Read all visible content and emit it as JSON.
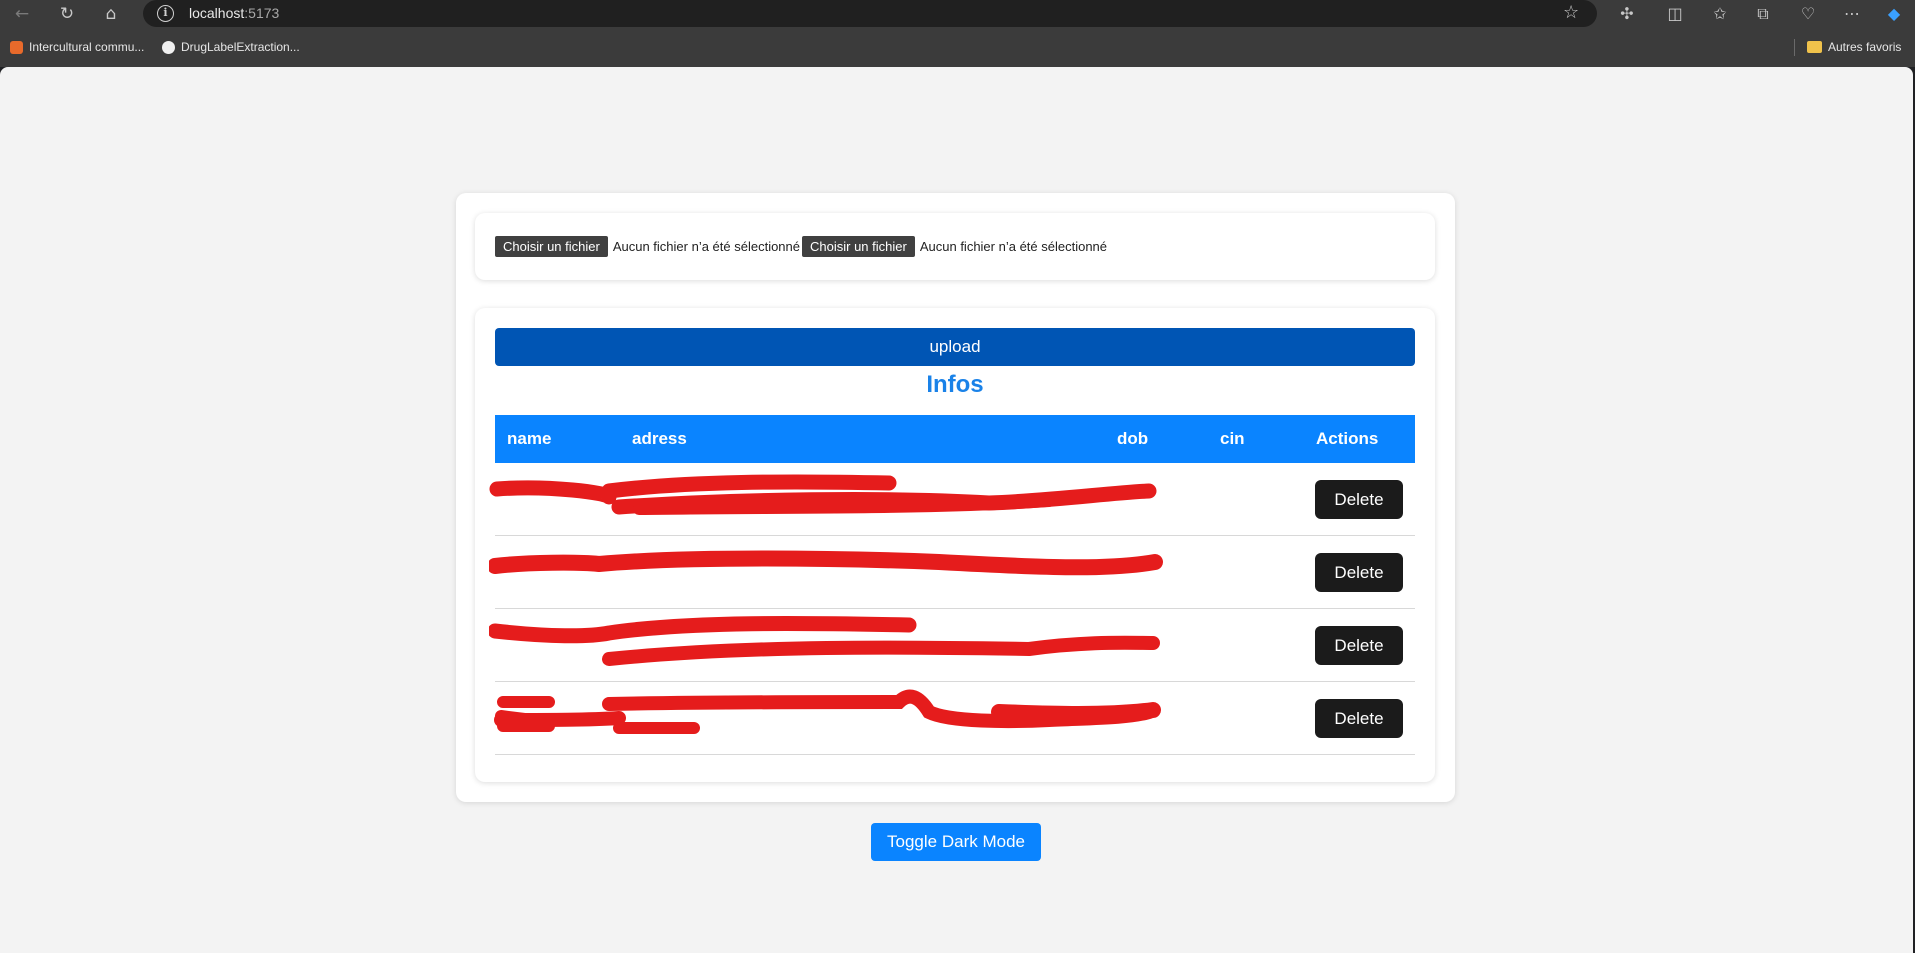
{
  "browser": {
    "url_host": "localhost",
    "url_port": ":5173",
    "bookmarks": [
      {
        "label": "Intercultural commu..."
      },
      {
        "label": "DrugLabelExtraction..."
      }
    ],
    "other_favorites": "Autres favoris"
  },
  "file_inputs": [
    {
      "button": "Choisir un fichier",
      "status": "Aucun fichier n’a été sélectionné"
    },
    {
      "button": "Choisir un fichier",
      "status": "Aucun fichier n’a été sélectionné"
    }
  ],
  "upload_label": "upload",
  "infos_title": "Infos",
  "table": {
    "headers": [
      "name",
      "adress",
      "dob",
      "cin",
      "Actions"
    ],
    "rows": [
      {
        "name": "",
        "adress": "",
        "dob": "",
        "cin": "",
        "action": "Delete"
      },
      {
        "name": "",
        "adress": "",
        "dob": "",
        "cin": "",
        "action": "Delete"
      },
      {
        "name": "",
        "adress": "",
        "dob": "",
        "cin": "",
        "action": "Delete"
      },
      {
        "name": "",
        "adress": "",
        "dob": "",
        "cin": "",
        "action": "Delete"
      }
    ]
  },
  "toggle_label": "Toggle Dark Mode",
  "colors": {
    "header_blue": "#0a84ff",
    "upload_blue": "#0055b4",
    "title_blue": "#1a82e8",
    "delete_bg": "#1b1b1b",
    "redaction_red": "#e51c1c"
  }
}
